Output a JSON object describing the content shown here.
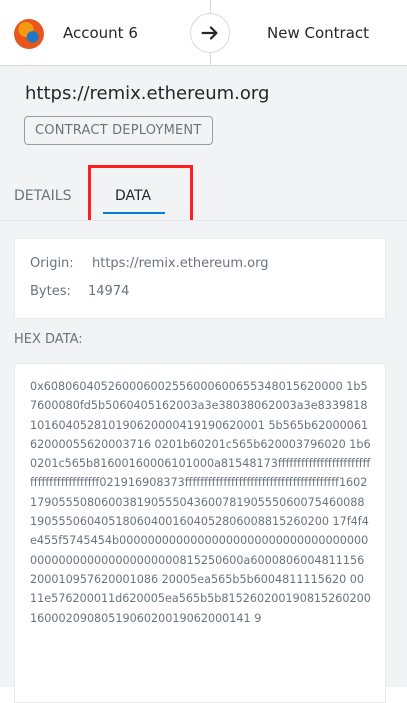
{
  "header": {
    "account_name": "Account 6",
    "arrow_icon": "arrow-right-icon",
    "new_contract_label": "New Contract"
  },
  "origin": {
    "url": "https://remix.ethereum.org",
    "badge": "CONTRACT DEPLOYMENT"
  },
  "tabs": {
    "details": "DETAILS",
    "data": "DATA",
    "active": "DATA"
  },
  "info": {
    "origin_label": "Origin:",
    "origin_value": "https://remix.ethereum.org",
    "bytes_label": "Bytes:",
    "bytes_value": "14974"
  },
  "hex": {
    "label": "HEX DATA:",
    "value": "0x608060405260006002556000600655348015620000 1b57600080fd5b5060405162003a3e38038062003a3e8339818101604052810190620000419190620001 5b565b6200006162000055620003716 0201b60201c565b620003796020 1b60201c565b81600160006101000a81548173ffffffffffffffffffffffffffffffffffffffffff021916908373ffffffffffffffffffffffffffffffffffffffff160217905550806003819055504360078190555060075460088190555060405180604001604052806008815260200 17f4f4e455f5745454b00000000000000000000000000000000000000000000000000000000815250600a6000806004811156200010957620001086 20005ea565b5b6004811115620 0011e576200011d620005ea565b5b8152602001908152602001600020908051906020019062000141 9"
  },
  "colors": {
    "accent": "#037dd6",
    "highlight": "#ff1f1f",
    "panel_bg": "#f2f3f4"
  }
}
